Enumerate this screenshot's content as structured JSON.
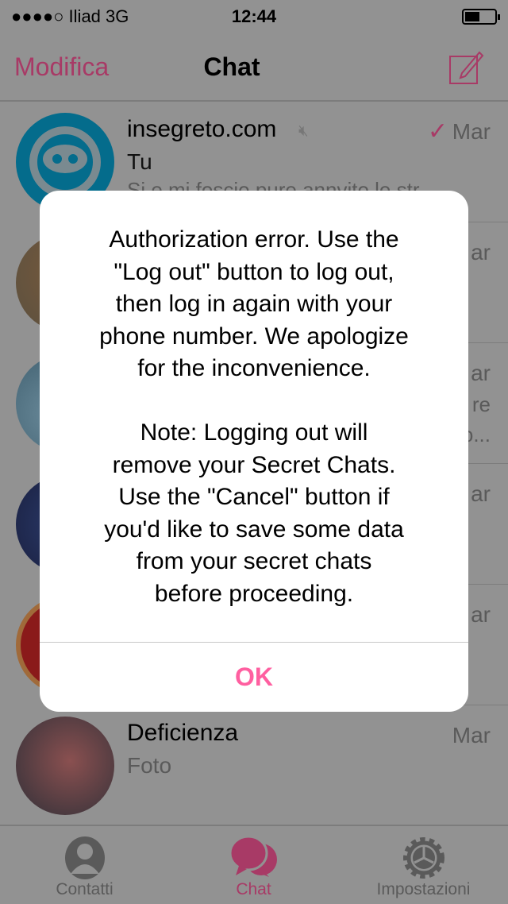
{
  "status": {
    "carrier": "●●●●○ Iliad   3G",
    "time": "12:44"
  },
  "nav": {
    "edit": "Modifica",
    "title": "Chat"
  },
  "chats": [
    {
      "name": "insegreto.com",
      "sender": "Tu",
      "preview": "Si e mi foscio pure annvito le str...",
      "date": "Mar",
      "muted": true,
      "read": true
    },
    {
      "date": "ar"
    },
    {
      "date": "ar",
      "frag1": "re",
      "frag2": "o..."
    },
    {
      "date": "ar"
    },
    {
      "date": "ar"
    },
    {
      "name": "Deficienza",
      "sender": "Foto",
      "date": "Mar"
    }
  ],
  "tabs": [
    {
      "label": "Contatti",
      "icon": "person-icon"
    },
    {
      "label": "Chat",
      "icon": "chat-bubbles-icon",
      "active": true
    },
    {
      "label": "Impostazioni",
      "icon": "gear-icon"
    }
  ],
  "alert": {
    "message": "Authorization error. Use the\n\"Log out\" button to log out,\nthen log in again with your\nphone number. We apologize\nfor the inconvenience.\n\nNote: Logging out will\nremove your Secret Chats.\nUse the \"Cancel\" button if\nyou'd like to save some data\nfrom your secret chats\nbefore proceeding.",
    "ok": "OK"
  },
  "colors": {
    "accent": "#a83a66",
    "ok": "#ff5fa0",
    "dim_bg": "#929292"
  }
}
